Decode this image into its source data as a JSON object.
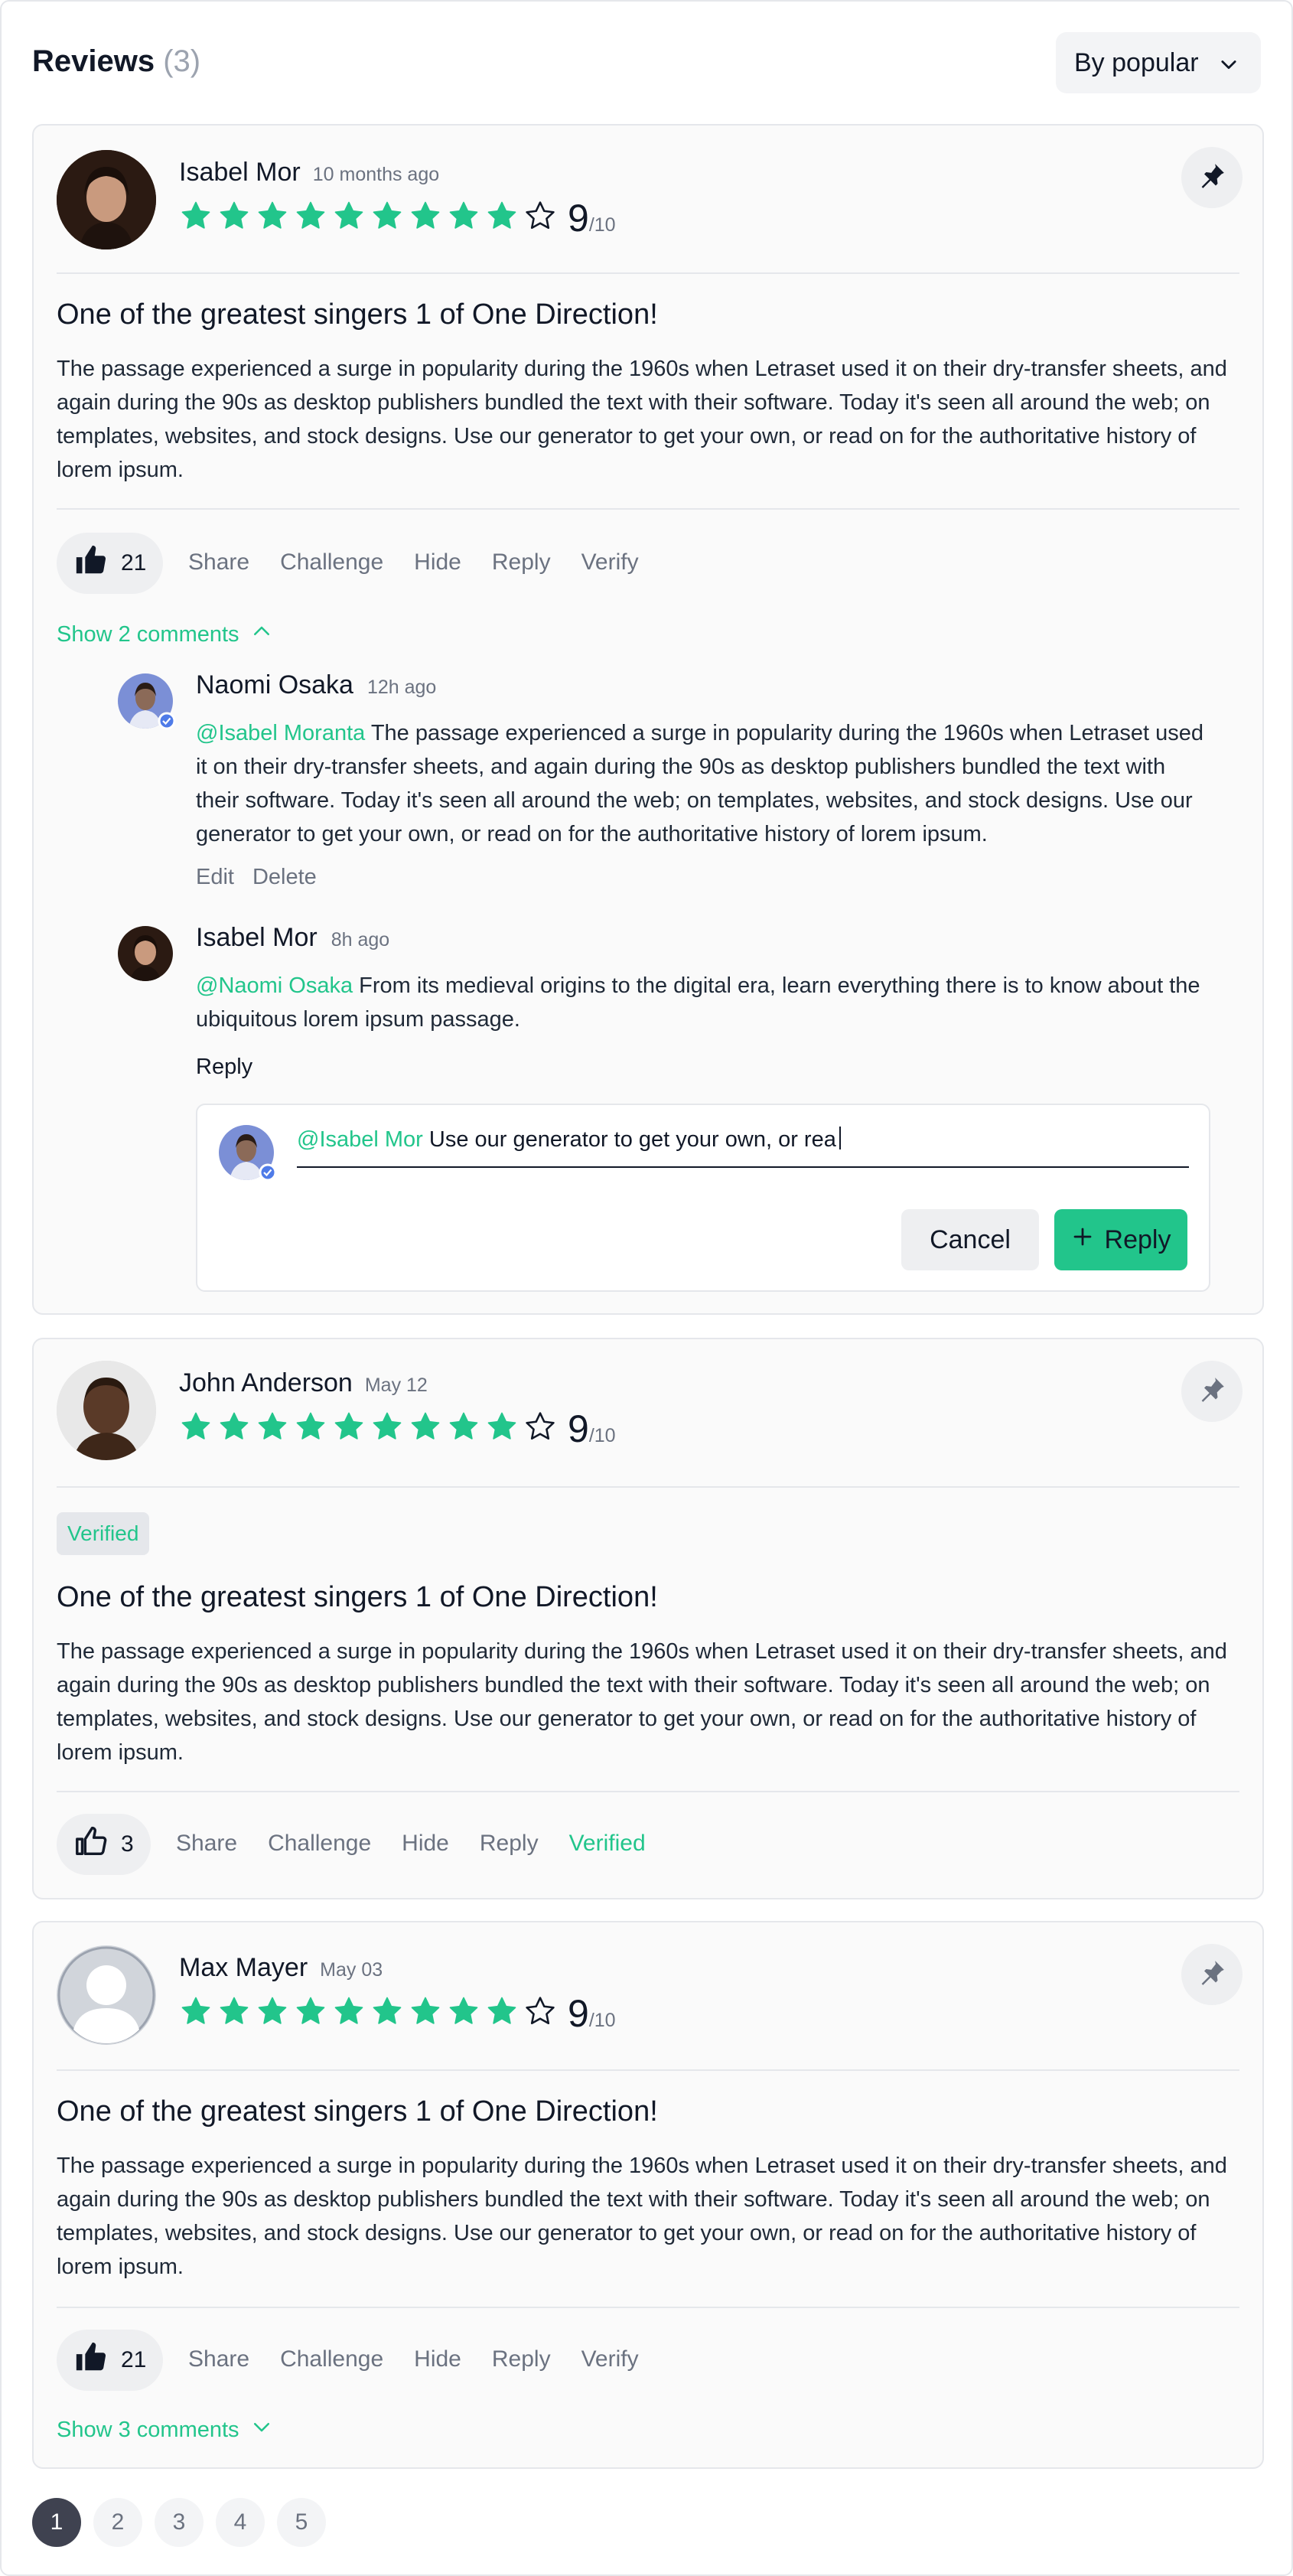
{
  "header": {
    "title": "Reviews",
    "count": "(3)",
    "sort_label": "By popular"
  },
  "colors": {
    "accent": "#22c58b",
    "star_empty_stroke": "#111827"
  },
  "reviews": [
    {
      "author": "Isabel Mor",
      "date": "10 months ago",
      "rating": 9,
      "rating_max": 10,
      "score": "9",
      "score_of": "/10",
      "title": "One of the greatest singers 1 of One Direction!",
      "body": "The passage experienced a surge in popularity during the 1960s when Letraset used it on their dry-transfer sheets, and again during the 90s as desktop publishers bundled the text with their software. Today it's seen all around the web; on templates, websites, and stock designs. Use our generator to get your own, or read on for the authoritative history of lorem ipsum.",
      "likes": "21",
      "actions": [
        "Share",
        "Challenge",
        "Hide",
        "Reply",
        "Verify"
      ],
      "show_comments": "Show 2 comments",
      "comments": [
        {
          "author": "Naomi Osaka",
          "time": "12h ago",
          "mention": "@Isabel Moranta",
          "text": " The passage experienced a surge in popularity during the 1960s when Letraset used it on their dry-transfer sheets, and again during the 90s as desktop publishers bundled the text with their software. Today it's seen all around the web; on templates, websites, and stock designs. Use our generator to get your own, or read on for the authoritative history of lorem ipsum.",
          "links": [
            "Edit",
            "Delete"
          ]
        },
        {
          "author": "Isabel Mor",
          "time": "8h ago",
          "mention": "@Naomi Osaka",
          "text": " From its medieval origins to the digital era, learn everything there is to know about the ubiquitous lorem ipsum passage.",
          "reply_label": "Reply"
        }
      ],
      "reply_box": {
        "mention": "@Isabel Mor",
        "value": " Use our generator to get your own, or rea",
        "cancel_label": "Cancel",
        "reply_label": "Reply"
      }
    },
    {
      "author": "John Anderson",
      "date": "May 12",
      "rating": 9,
      "rating_max": 10,
      "score": "9",
      "score_of": "/10",
      "badge": "Verified",
      "title": "One of the greatest singers 1 of One Direction!",
      "body": "The passage experienced a surge in popularity during the 1960s when Letraset used it on their dry-transfer sheets, and again during the 90s as desktop publishers bundled the text with their software. Today it's seen all around the web; on templates, websites, and stock designs. Use our generator to get your own, or read on for the authoritative history of lorem ipsum.",
      "likes": "3",
      "actions": [
        "Share",
        "Challenge",
        "Hide",
        "Reply",
        "Verified"
      ]
    },
    {
      "author": "Max Mayer",
      "date": "May 03",
      "rating": 9,
      "rating_max": 10,
      "score": "9",
      "score_of": "/10",
      "title": "One of the greatest singers 1 of One Direction!",
      "body": "The passage experienced a surge in popularity during the 1960s when Letraset used it on their dry-transfer sheets, and again during the 90s as desktop publishers bundled the text with their software. Today it's seen all around the web; on templates, websites, and stock designs. Use our generator to get your own, or read on for the authoritative history of lorem ipsum.",
      "likes": "21",
      "actions": [
        "Share",
        "Challenge",
        "Hide",
        "Reply",
        "Verify"
      ],
      "show_comments": "Show 3 comments"
    }
  ],
  "pagination": [
    "1",
    "2",
    "3",
    "4",
    "5"
  ]
}
